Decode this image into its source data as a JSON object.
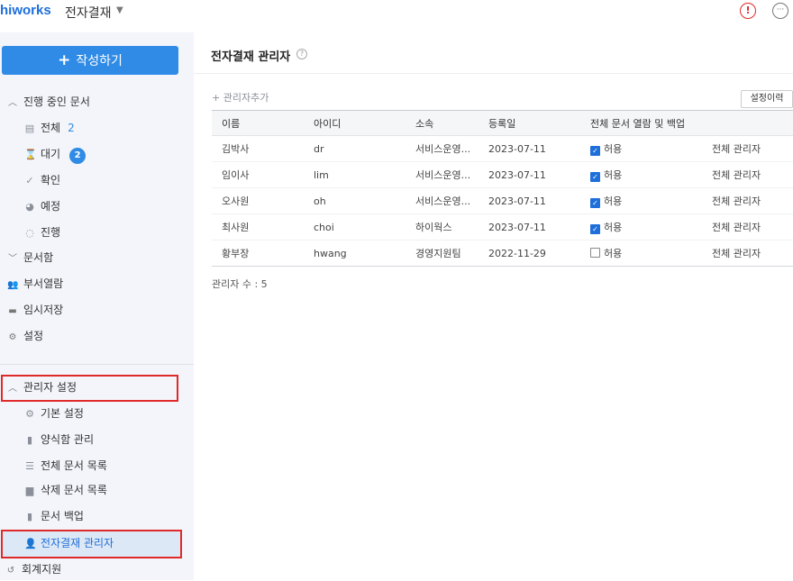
{
  "app": {
    "logo": "hiworks",
    "title": "전자결재",
    "caret": "▼",
    "alert_glyph": "!",
    "more_glyph": "···"
  },
  "sidebar": {
    "compose_label": "작성하기",
    "sections": [
      {
        "label": "진행 중인 문서",
        "icon": "chevron-up-icon",
        "items": [
          {
            "label": "전체",
            "count": "2",
            "icon": "documents-icon"
          },
          {
            "label": "대기",
            "badge": "2",
            "icon": "hourglass-icon"
          },
          {
            "label": "확인",
            "icon": "check-icon"
          },
          {
            "label": "예정",
            "icon": "clock-icon"
          },
          {
            "label": "진행",
            "icon": "progress-icon"
          }
        ]
      },
      {
        "label": "문서함",
        "icon": "chevron-down-icon"
      }
    ],
    "items": [
      {
        "label": "부서열람",
        "icon": "people-icon"
      },
      {
        "label": "임시저장",
        "icon": "box-icon"
      },
      {
        "label": "설정",
        "icon": "gear-icon"
      }
    ],
    "admin_section": {
      "label": "관리자 설정",
      "icon": "chevron-up-icon",
      "items": [
        {
          "label": "기본 설정",
          "icon": "gear-icon"
        },
        {
          "label": "양식함 관리",
          "icon": "file-icon"
        },
        {
          "label": "전체 문서 목록",
          "icon": "list-icon"
        },
        {
          "label": "삭제 문서 목록",
          "icon": "trash-icon"
        },
        {
          "label": "문서 백업",
          "icon": "backup-icon"
        },
        {
          "label": "전자결재 관리자",
          "icon": "admin-user-icon"
        }
      ]
    },
    "bottom_item": {
      "label": "회계지원",
      "icon": "history-icon"
    }
  },
  "main": {
    "title": "전자결재 관리자",
    "help_glyph": "?",
    "add_admin": "+ 관리자추가",
    "history_button": "설정이력",
    "columns": [
      "이름",
      "아이디",
      "소속",
      "등록일",
      "전체 문서 열람 및 백업",
      ""
    ],
    "rows": [
      {
        "name": "김박사",
        "id": "dr",
        "org": "서비스운영...",
        "date": "2023-07-11",
        "allow": true,
        "allow_label": "허용",
        "role": "전체 관리자"
      },
      {
        "name": "임이사",
        "id": "lim",
        "org": "서비스운영...",
        "date": "2023-07-11",
        "allow": true,
        "allow_label": "허용",
        "role": "전체 관리자"
      },
      {
        "name": "오사원",
        "id": "oh",
        "org": "서비스운영...",
        "date": "2023-07-11",
        "allow": true,
        "allow_label": "허용",
        "role": "전체 관리자"
      },
      {
        "name": "최사원",
        "id": "choi",
        "org": "하이웍스",
        "date": "2023-07-11",
        "allow": true,
        "allow_label": "허용",
        "role": "전체 관리자"
      },
      {
        "name": "황부장",
        "id": "hwang",
        "org": "경영지원팀",
        "date": "2022-11-29",
        "allow": false,
        "allow_label": "허용",
        "role": "전체 관리자"
      }
    ],
    "count_label": "관리자 수 : 5"
  },
  "colors": {
    "accent": "#2f8be6",
    "link": "#1e6fd9",
    "highlight": "#e02a2a",
    "sidebar_bg": "#f3f5fa"
  }
}
